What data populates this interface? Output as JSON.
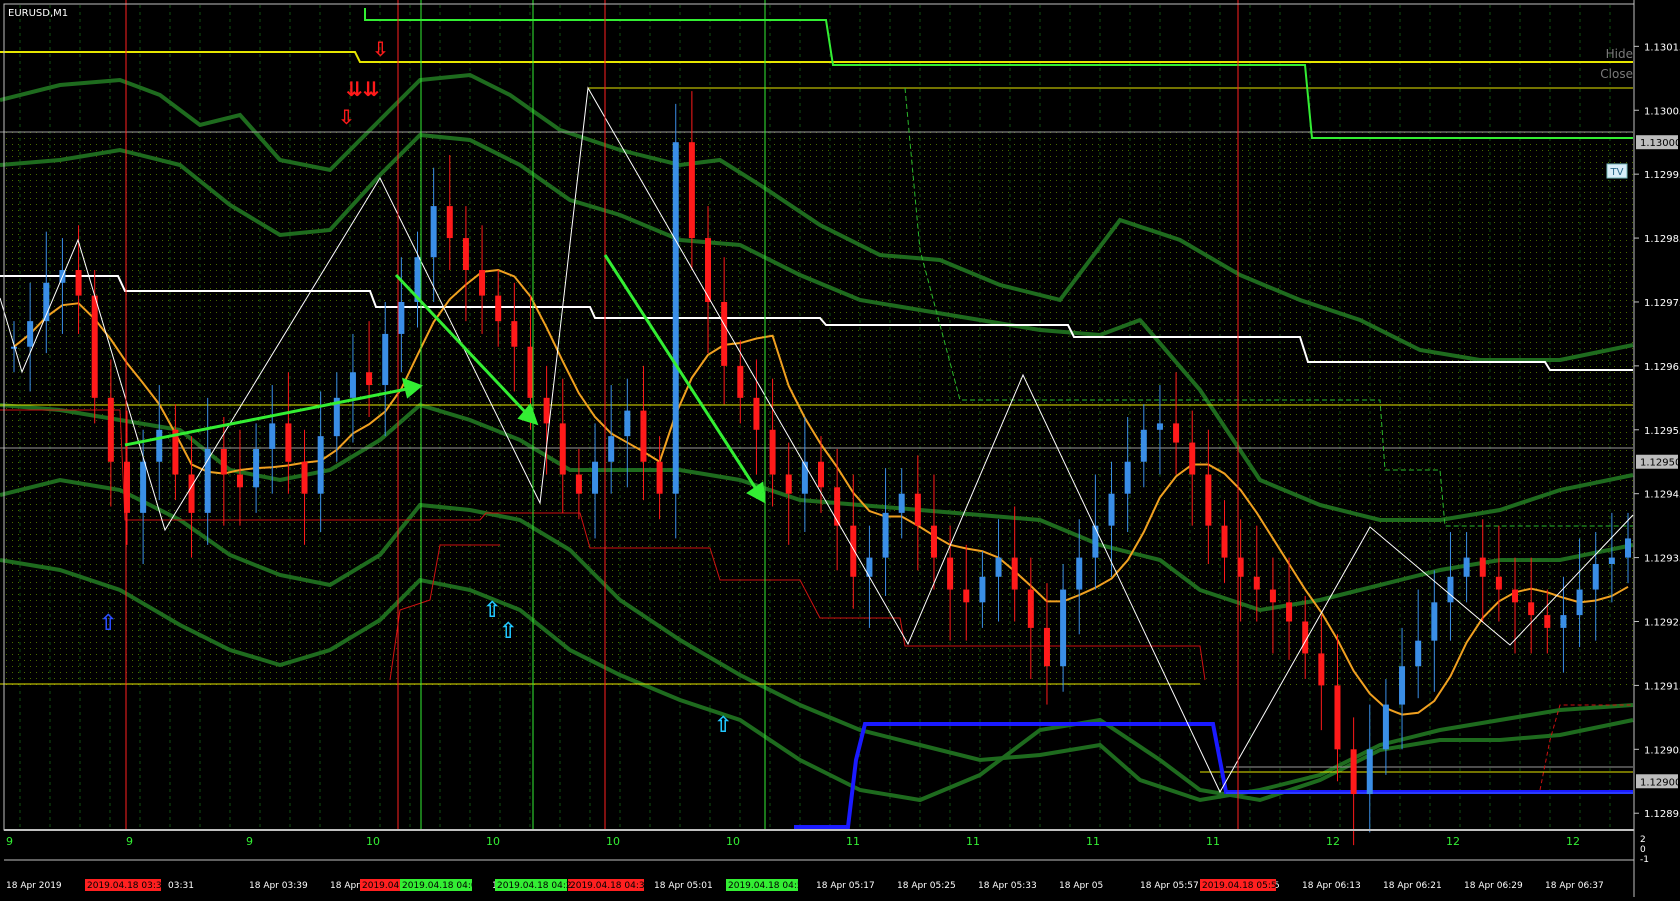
{
  "window": {
    "symbol_label": "EURUSD,M1"
  },
  "buttons": {
    "hide": "Hide",
    "close": "Close",
    "tv": "TV"
  },
  "price_axis": {
    "ticks": [
      "1.13015",
      "1.13005",
      "1.12995",
      "1.12985",
      "1.12975",
      "1.12965",
      "1.12955",
      "1.12945",
      "1.12935",
      "1.12925",
      "1.12915",
      "1.12905",
      "1.12895"
    ],
    "highlighted": [
      "1.13000",
      "1.12950",
      "1.12900"
    ]
  },
  "indicator_strip": {
    "labels": [
      "9",
      "9",
      "9",
      "10",
      "10",
      "10",
      "10",
      "11",
      "11",
      "11",
      "11",
      "12",
      "12",
      "12"
    ],
    "right_values": [
      "2",
      "0",
      "-1"
    ]
  },
  "time_axis": {
    "labels": [
      "18 Apr 2019",
      "18 Apr",
      "03:31",
      "18 Apr 03:39",
      "18 Apr 03:47",
      "18 Apr",
      "18 Apr 04",
      "04:53",
      "18 Apr 05:01",
      "18 Apr 05:09",
      "18 Apr 05:17",
      "18 Apr 05:25",
      "18 Apr 05:33",
      "18 Apr 05",
      "18 Apr 05:57",
      "18 Apr 06:05",
      "18 Apr 06:13",
      "18 Apr 06:21",
      "18 Apr 06:29",
      "18 Apr 06:37"
    ],
    "red_markers": [
      "2019.04.18 03:30",
      "2019.04.18 04:04",
      "2019.04.18 04:32",
      "2019.04.18 05:51"
    ],
    "green_markers": [
      "2019.04.18 04:07",
      "2019.04.18 04:2",
      "2019.04.18 04:52"
    ]
  },
  "colors": {
    "background": "#000000",
    "bull_candle": "#3a8ee6",
    "bear_candle": "#ff1a1a",
    "bollinger": "#1e6b1e",
    "ma": "#f0a020",
    "zigzag": "#ffffff",
    "trend_arrow": "#33ee33",
    "yellow_level": "#e6e600",
    "blue_line": "#1a1aff"
  },
  "chart_data": {
    "type": "candlestick",
    "symbol": "EURUSD",
    "timeframe": "M1",
    "ylim": [
      1.12893,
      1.13021
    ],
    "candles_close": [
      1.12968,
      1.12972,
      1.12978,
      1.1298,
      1.12976,
      1.1296,
      1.1295,
      1.12942,
      1.1295,
      1.12955,
      1.12948,
      1.12942,
      1.12952,
      1.12948,
      1.12946,
      1.12952,
      1.12956,
      1.1295,
      1.12945,
      1.12954,
      1.1296,
      1.12964,
      1.12962,
      1.1297,
      1.12975,
      1.12982,
      1.1299,
      1.12985,
      1.1298,
      1.12976,
      1.12972,
      1.12968,
      1.1296,
      1.12956,
      1.12948,
      1.12945,
      1.1295,
      1.12954,
      1.12958,
      1.1295,
      1.12945,
      1.13,
      1.12985,
      1.12975,
      1.12965,
      1.1296,
      1.12955,
      1.12948,
      1.12945,
      1.1295,
      1.12946,
      1.1294,
      1.12932,
      1.12935,
      1.12942,
      1.12945,
      1.1294,
      1.12935,
      1.1293,
      1.12928,
      1.12932,
      1.12935,
      1.1293,
      1.12924,
      1.12918,
      1.1293,
      1.12935,
      1.1294,
      1.12945,
      1.1295,
      1.12955,
      1.12956,
      1.12953,
      1.12948,
      1.1294,
      1.12935,
      1.12932,
      1.1293,
      1.12928,
      1.12925,
      1.1292,
      1.12915,
      1.12905,
      1.12898,
      1.12905,
      1.12912,
      1.12918,
      1.12922,
      1.12928,
      1.12932,
      1.12935,
      1.12932,
      1.1293,
      1.12928,
      1.12926,
      1.12924,
      1.12926,
      1.1293,
      1.12934,
      1.12935,
      1.12938
    ]
  }
}
